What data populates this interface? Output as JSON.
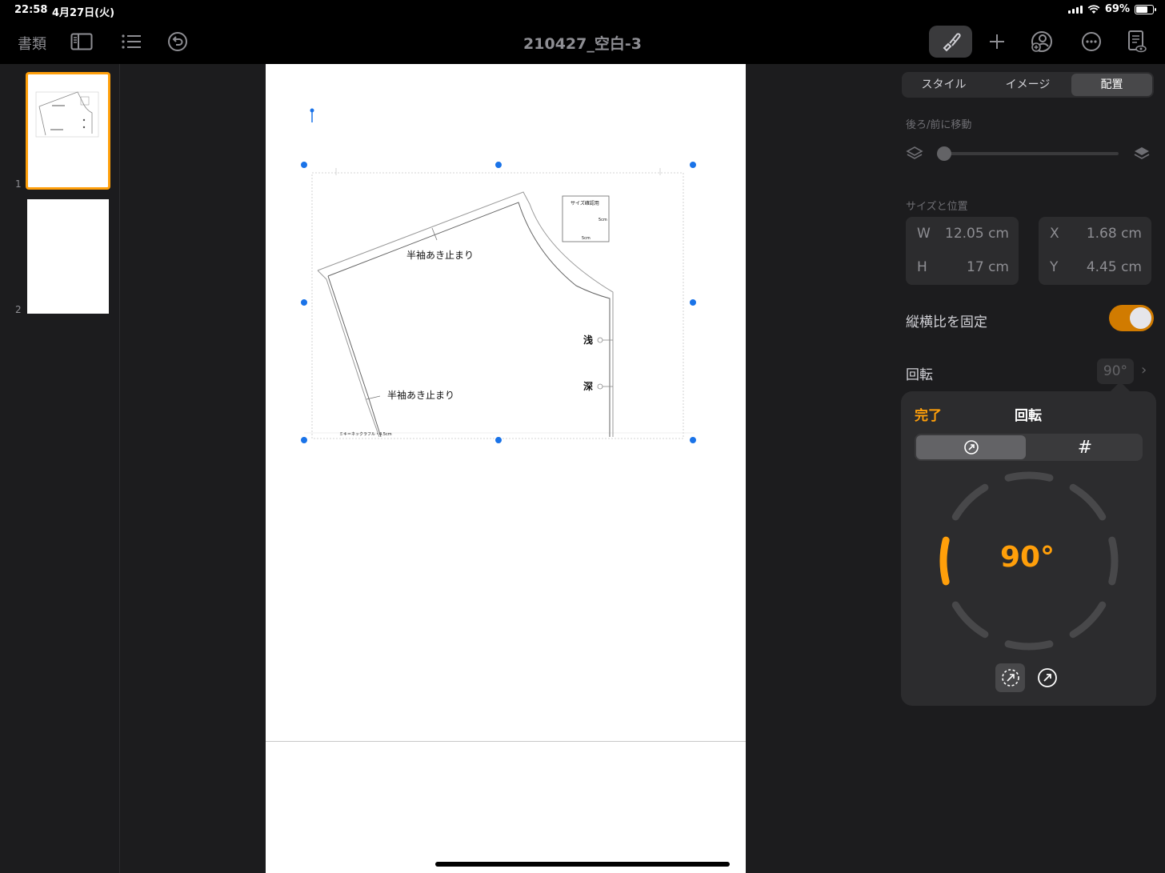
{
  "status": {
    "time": "22:58",
    "date": "4月27日(火)",
    "battery": "69%",
    "battery_level": 0.69
  },
  "toolbar": {
    "docs_label": "書類",
    "title": "210427_空白-3"
  },
  "sidebar": {
    "pages": [
      {
        "number": "1",
        "selected": true
      },
      {
        "number": "2",
        "selected": false
      }
    ]
  },
  "canvas": {
    "labels": {
      "sleeve_top": "半袖あき止まり",
      "sleeve_bottom": "半袖あき止まり",
      "shallow": "浅",
      "deep": "深",
      "size_check_title": "サイズ確認用",
      "size_check_h": "5cm",
      "size_check_w": "5cm",
      "footer_note": "ミキ＝ネックラフル・4.5cm"
    }
  },
  "inspector": {
    "tabs": [
      {
        "label": "スタイル",
        "active": false
      },
      {
        "label": "イメージ",
        "active": false
      },
      {
        "label": "配置",
        "active": true
      }
    ],
    "layer_label": "後ろ/前に移動",
    "layer_position": 0.0,
    "size_label": "サイズと位置",
    "width": {
      "key": "W",
      "value": "12.05 cm"
    },
    "height": {
      "key": "H",
      "value": "17 cm"
    },
    "x": {
      "key": "X",
      "value": "1.68 cm"
    },
    "y": {
      "key": "Y",
      "value": "4.45 cm"
    },
    "lock_aspect_label": "縦横比を固定",
    "lock_aspect_on": true,
    "rotation_label": "回転",
    "rotation_value": "90°"
  },
  "popover": {
    "done_label": "完了",
    "title": "回転",
    "numeric_tab_symbol": "#",
    "dial_value": "90°",
    "accent": "#ff9f0a"
  }
}
